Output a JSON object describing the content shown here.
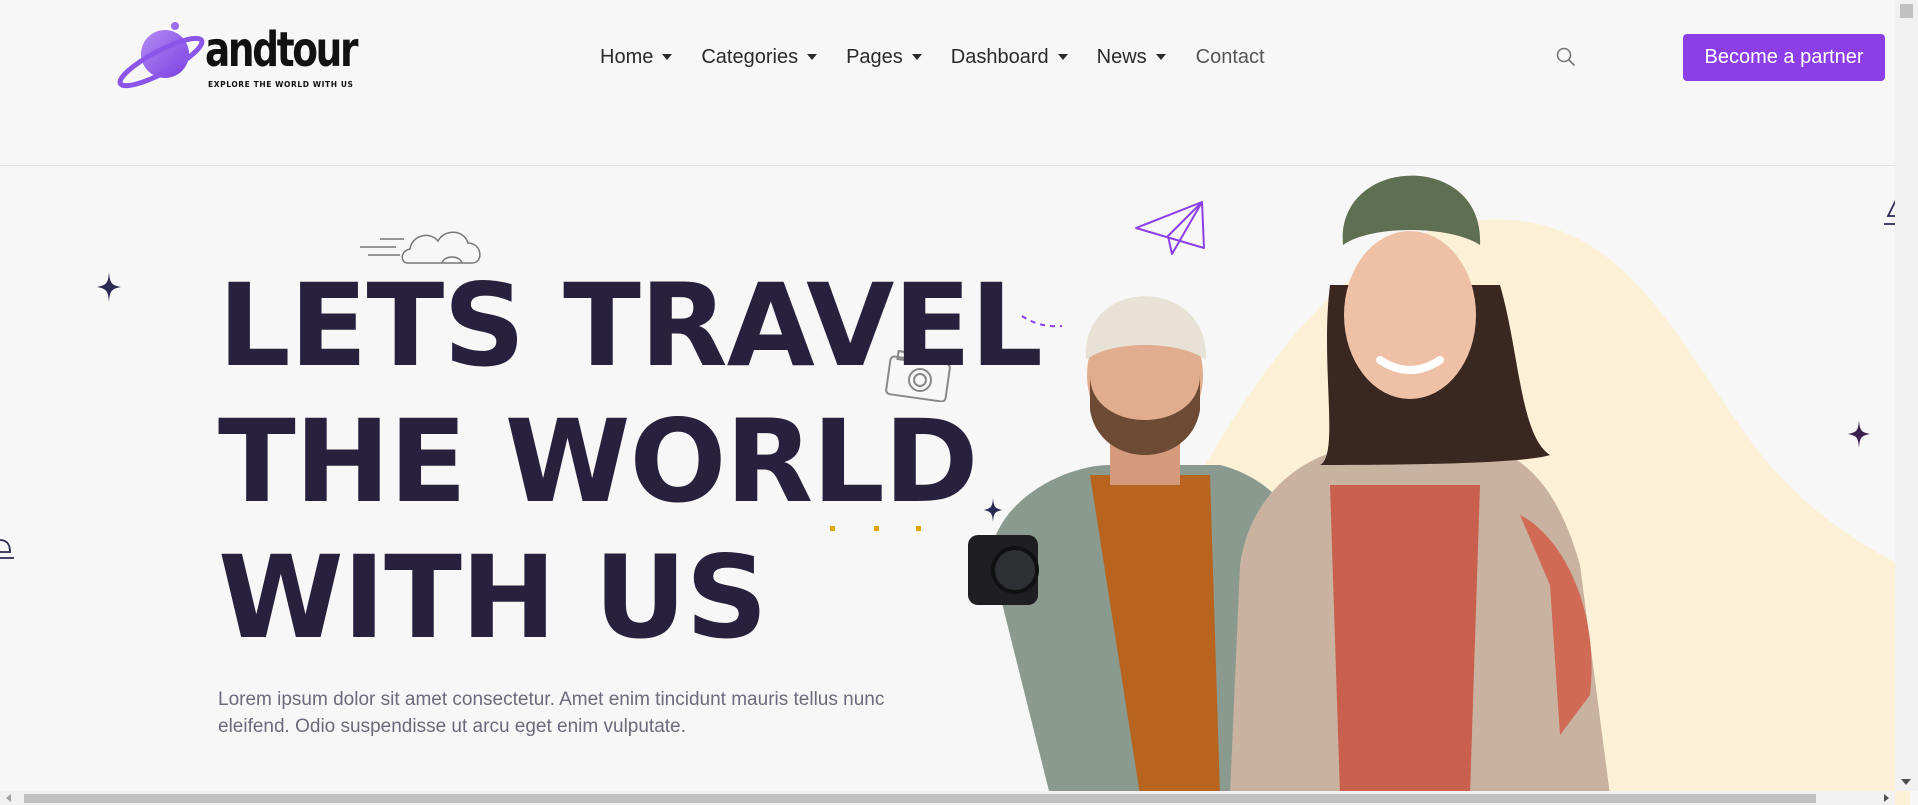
{
  "brand": {
    "name": "andtour",
    "tagline": "EXPLORE THE WORLD WITH US",
    "accent": "#8c3fe8"
  },
  "nav": {
    "items": [
      {
        "label": "Home",
        "has_dropdown": true
      },
      {
        "label": "Categories",
        "has_dropdown": true
      },
      {
        "label": "Pages",
        "has_dropdown": true
      },
      {
        "label": "Dashboard",
        "has_dropdown": true
      },
      {
        "label": "News",
        "has_dropdown": true
      },
      {
        "label": "Contact",
        "has_dropdown": false
      }
    ],
    "search_icon": "search-icon",
    "cta_label": "Become a partner"
  },
  "hero": {
    "title_lines": [
      "LETS TRAVEL",
      "THE WORLD",
      "WITH US"
    ],
    "description": "Lorem ipsum dolor sit amet consectetur. Amet enim tincidunt mauris tellus nunc eleifend. Odio suspendisse ut arcu eget enim vulputate.",
    "title_color": "#27213d",
    "blob_color": "#fcf1d7"
  }
}
